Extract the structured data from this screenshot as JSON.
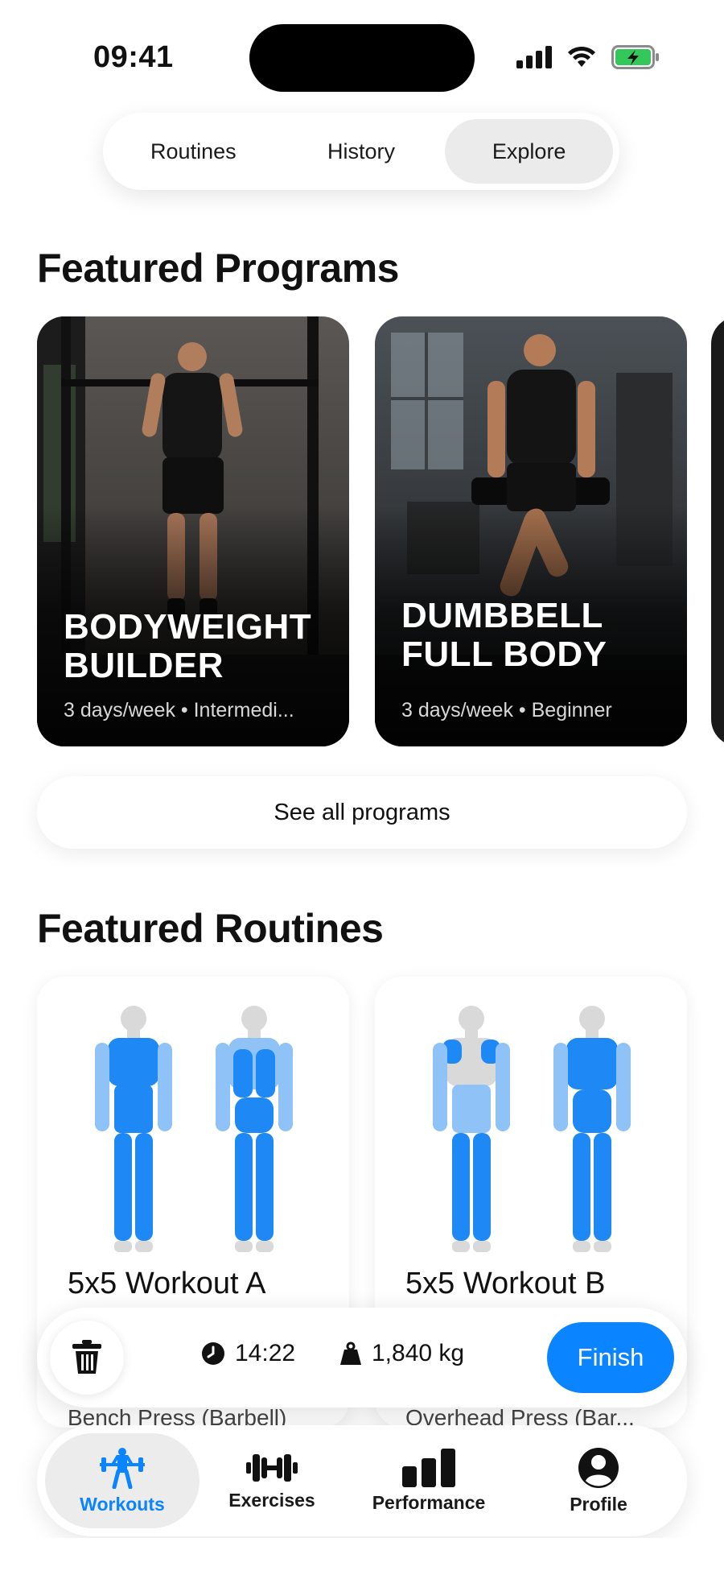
{
  "status_bar": {
    "time": "09:41"
  },
  "segments": [
    {
      "label": "Routines",
      "active": false
    },
    {
      "label": "History",
      "active": false
    },
    {
      "label": "Explore",
      "active": true
    }
  ],
  "featured_programs": {
    "title": "Featured Programs",
    "cards": [
      {
        "title_line1": "BODYWEIGHT",
        "title_line2": "BUILDER",
        "subtitle": "3 days/week • Intermedi..."
      },
      {
        "title_line1": "DUMBBELL",
        "title_line2": "FULL BODY",
        "subtitle": "3 days/week • Beginner"
      }
    ],
    "see_all_label": "See all programs"
  },
  "featured_routines": {
    "title": "Featured Routines",
    "cards": [
      {
        "name": "5x5 Workout A",
        "exercise": "Bench Press (Barbell)"
      },
      {
        "name": "5x5 Workout B",
        "exercise": "Overhead Press (Bar..."
      }
    ]
  },
  "active_workout": {
    "duration": "14:22",
    "volume": "1,840 kg",
    "finish_label": "Finish"
  },
  "tab_bar": {
    "items": [
      {
        "label": "Workouts",
        "icon": "barbell-lifter-icon",
        "active": true
      },
      {
        "label": "Exercises",
        "icon": "dumbbell-icon",
        "active": false
      },
      {
        "label": "Performance",
        "icon": "bar-chart-icon",
        "active": false
      },
      {
        "label": "Profile",
        "icon": "person-circle-icon",
        "active": false
      }
    ]
  },
  "colors": {
    "accent": "#0a84ff",
    "muscle_primary": "#1e88f5",
    "muscle_secondary": "#8fc3f7",
    "body_base": "#d9d9d9",
    "battery": "#34c759"
  }
}
